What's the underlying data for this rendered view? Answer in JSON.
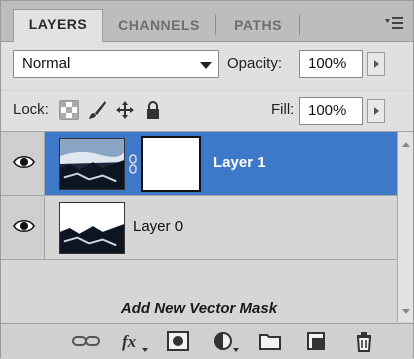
{
  "tabs": [
    {
      "label": "LAYERS",
      "active": true
    },
    {
      "label": "CHANNELS",
      "active": false
    },
    {
      "label": "PATHS",
      "active": false
    }
  ],
  "blend": {
    "mode": "Normal",
    "opacity_label": "Opacity:",
    "opacity_value": "100%"
  },
  "lock": {
    "label": "Lock:",
    "fill_label": "Fill:",
    "fill_value": "100%",
    "icons": [
      "lock-transparent-pixels-icon",
      "lock-image-pixels-icon",
      "lock-position-icon",
      "lock-all-icon"
    ]
  },
  "layers": [
    {
      "name": "Layer 1",
      "selected": true,
      "visible": true,
      "has_mask": true
    },
    {
      "name": "Layer 0",
      "selected": false,
      "visible": true,
      "has_mask": false
    }
  ],
  "caption": "Add New Vector Mask",
  "toolbar": [
    "link-layers-icon",
    "layer-style-fx-icon",
    "add-mask-icon",
    "adjustment-layer-icon",
    "new-group-icon",
    "new-layer-icon",
    "delete-layer-icon"
  ],
  "colors": {
    "selection": "#3d78c9",
    "panel": "#d6d6d6"
  }
}
